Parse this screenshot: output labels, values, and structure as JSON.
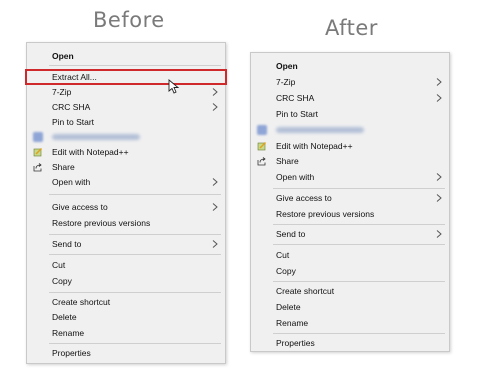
{
  "headings": {
    "before": "Before",
    "after": "After"
  },
  "before_menu": {
    "items": {
      "open": "Open",
      "extract_all": "Extract All...",
      "seven_zip": "7-Zip",
      "crc_sha": "CRC SHA",
      "pin_to_start": "Pin to Start",
      "edit_notepad": "Edit with Notepad++",
      "share": "Share",
      "open_with": "Open with",
      "give_access": "Give access to",
      "restore_prev": "Restore previous versions",
      "send_to": "Send to",
      "cut": "Cut",
      "copy": "Copy",
      "create_shortcut": "Create shortcut",
      "delete": "Delete",
      "rename": "Rename",
      "properties": "Properties"
    }
  },
  "after_menu": {
    "items": {
      "open": "Open",
      "seven_zip": "7-Zip",
      "crc_sha": "CRC SHA",
      "pin_to_start": "Pin to Start",
      "edit_notepad": "Edit with Notepad++",
      "share": "Share",
      "open_with": "Open with",
      "give_access": "Give access to",
      "restore_prev": "Restore previous versions",
      "send_to": "Send to",
      "cut": "Cut",
      "copy": "Copy",
      "create_shortcut": "Create shortcut",
      "delete": "Delete",
      "rename": "Rename",
      "properties": "Properties"
    }
  },
  "colors": {
    "highlight": "#d0292c",
    "menu_bg": "#f0f0f0",
    "heading": "#7a7a7a"
  },
  "icons": [
    "blurred-app-icon",
    "notepad-plus-plus-icon",
    "share-icon",
    "chevron-right-icon",
    "mouse-cursor-icon"
  ]
}
